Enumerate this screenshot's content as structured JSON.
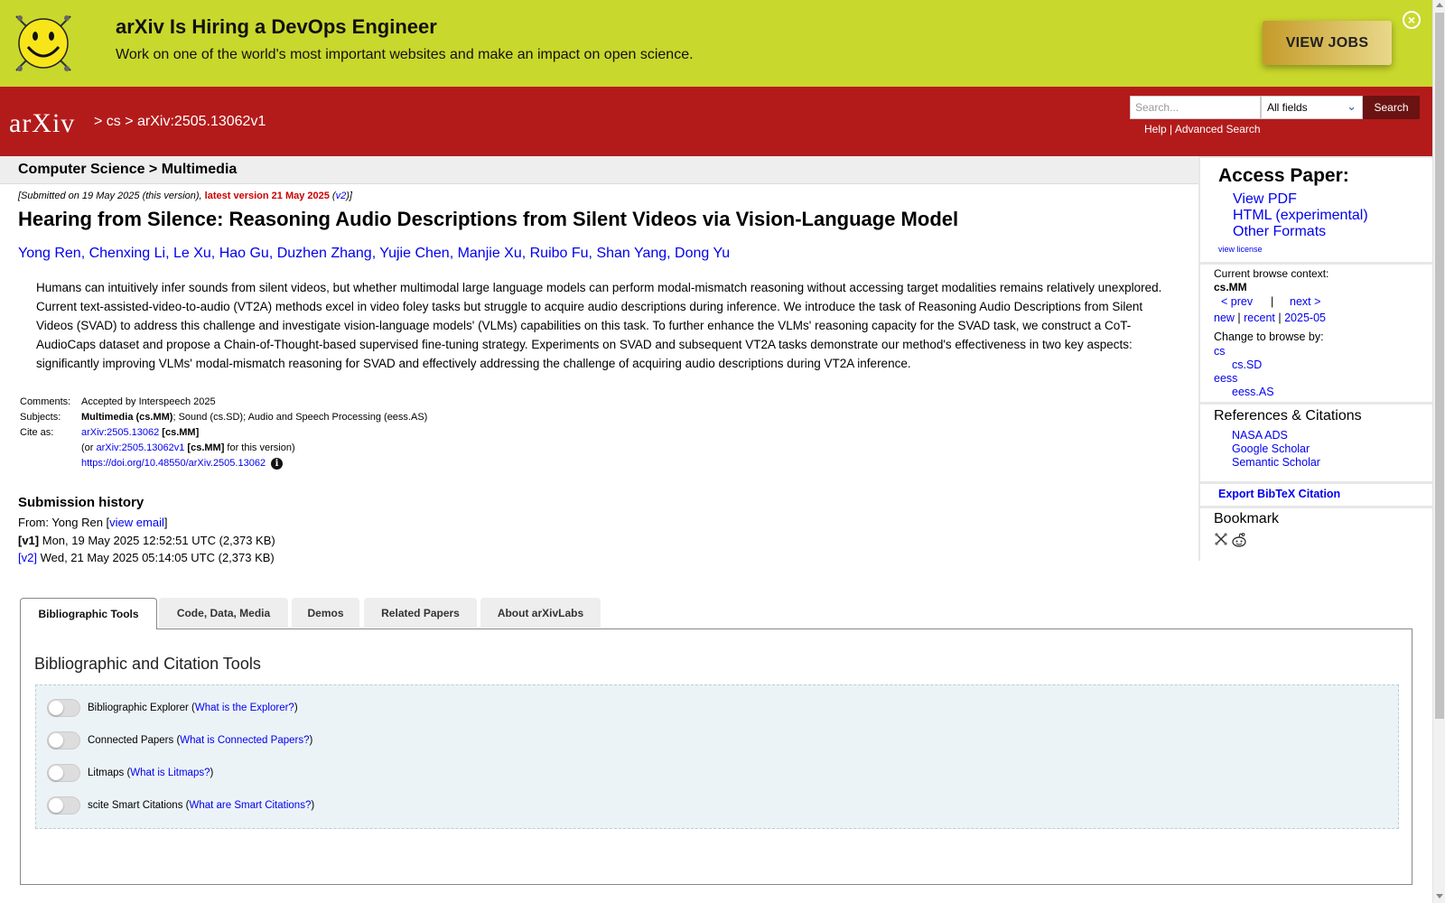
{
  "banner": {
    "title": "arXiv Is Hiring a DevOps Engineer",
    "subtitle": "Work on one of the world's most important websites and make an impact on open science.",
    "button": "VIEW JOBS"
  },
  "header": {
    "logo_text": "arXiv",
    "breadcrumb": "> cs > arXiv:2505.13062v1",
    "search_placeholder": "Search...",
    "field_select": "All fields",
    "search_button": "Search",
    "help_link": "Help",
    "advanced_link": "Advanced Search",
    "link_separator": " | "
  },
  "subhead": "Computer Science > Multimedia",
  "paper": {
    "dateline_prefix": "[Submitted on 19 May 2025 (this version), ",
    "latest": "latest version 21 May 2025",
    "dateline_open": " (",
    "dateline_v2": "v2",
    "dateline_close": ")]",
    "title": "Hearing from Silence: Reasoning Audio Descriptions from Silent Videos via Vision-Language Model",
    "authors": [
      "Yong Ren",
      "Chenxing Li",
      "Le Xu",
      "Hao Gu",
      "Duzhen Zhang",
      "Yujie Chen",
      "Manjie Xu",
      "Ruibo Fu",
      "Shan Yang",
      "Dong Yu"
    ],
    "author_separator": ", ",
    "abstract": "Humans can intuitively infer sounds from silent videos, but whether multimodal large language models can perform modal-mismatch reasoning without accessing target modalities remains relatively unexplored. Current text-assisted-video-to-audio (VT2A) methods excel in video foley tasks but struggle to acquire audio descriptions during inference. We introduce the task of Reasoning Audio Descriptions from Silent Videos (SVAD) to address this challenge and investigate vision-language models' (VLMs) capabilities on this task. To further enhance the VLMs' reasoning capacity for the SVAD task, we construct a CoT-AudioCaps dataset and propose a Chain-of-Thought-based supervised fine-tuning strategy. Experiments on SVAD and subsequent VT2A tasks demonstrate our method's effectiveness in two key aspects: significantly improving VLMs' modal-mismatch reasoning for SVAD and effectively addressing the challenge of acquiring audio descriptions during VT2A inference.",
    "comments_label": "Comments:",
    "comments": "Accepted by Interspeech 2025",
    "subjects_label": "Subjects:",
    "subjects_primary": "Multimedia (cs.MM)",
    "subjects_rest": "; Sound (cs.SD); Audio and Speech Processing (eess.AS)",
    "cite_label": "Cite as:",
    "cite_id": "arXiv:2505.13062",
    "cite_cat": " [cs.MM]",
    "cite_version_prefix": "(or ",
    "cite_version_id": "arXiv:2505.13062v1",
    "cite_version_cat": " [cs.MM]",
    "cite_version_suffix": " for this version)",
    "doi": "https://doi.org/10.48550/arXiv.2505.13062",
    "doi_info_icon": "i"
  },
  "history": {
    "title": "Submission history",
    "from_prefix": "From: Yong Ren [",
    "view_email": "view email",
    "from_suffix": "]",
    "v1_tag": "[v1]",
    "v1": " Mon, 19 May 2025 12:52:51 UTC (2,373 KB)",
    "v2_tag": "[v2]",
    "v2": " Wed, 21 May 2025 05:14:05 UTC (2,373 KB)"
  },
  "sidebar": {
    "access_title": "Access Paper:",
    "access_links": [
      "View PDF",
      "HTML (experimental)",
      "Other Formats"
    ],
    "view_license": "view license",
    "context_label": "Current browse context:",
    "context_value": "cs.MM",
    "prev": "< prev",
    "nav_sep": "|",
    "next": "next >",
    "new": "new",
    "recent": "recent",
    "period": "2025-05",
    "period_sep": " | ",
    "change_label": "Change to browse by:",
    "categories": [
      "cs",
      "cs.SD",
      "eess",
      "eess.AS"
    ],
    "refs_title": "References & Citations",
    "refs": [
      "NASA ADS",
      "Google Scholar",
      "Semantic Scholar"
    ],
    "export": "Export BibTeX Citation",
    "bookmark_title": "Bookmark"
  },
  "tabs": [
    "Bibliographic Tools",
    "Code, Data, Media",
    "Demos",
    "Related Papers",
    "About arXivLabs"
  ],
  "panel": {
    "title": "Bibliographic and Citation Tools",
    "toggles": [
      {
        "label": "Bibliographic Explorer (",
        "link": "What is the Explorer?",
        "suffix": ")"
      },
      {
        "label": "Connected Papers (",
        "link": "What is Connected Papers?",
        "suffix": ")"
      },
      {
        "label": "Litmaps (",
        "link": "What is Litmaps?",
        "suffix": ")"
      },
      {
        "label": "scite Smart Citations (",
        "link": "What are Smart Citations?",
        "suffix": ")"
      }
    ]
  },
  "colors": {
    "banner": "#c9d82c",
    "header": "#b31b1b",
    "link": "#0000ee",
    "latest": "#cc0000"
  }
}
